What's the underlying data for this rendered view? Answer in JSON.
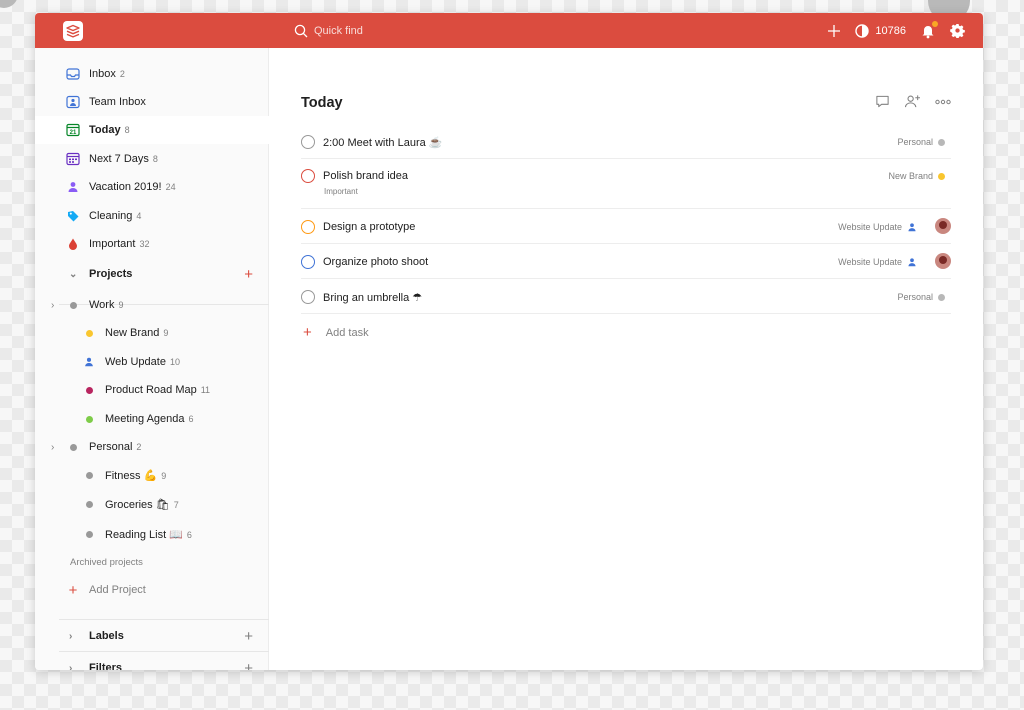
{
  "colors": {
    "brand": "#db4c3f",
    "accent_yellow": "#f9c62f",
    "blue": "#4073d6",
    "red": "#db4c3f",
    "orange": "#ff9a14"
  },
  "topbar": {
    "search_placeholder": "Quick find",
    "karma": "10786"
  },
  "sidebar": {
    "filters": [
      {
        "label": "Inbox",
        "count": "2",
        "icon": "inbox-icon"
      },
      {
        "label": "Team Inbox",
        "count": "",
        "icon": "team-inbox-icon"
      },
      {
        "label": "Today",
        "count": "8",
        "icon": "calendar-today-icon"
      },
      {
        "label": "Next 7 Days",
        "count": "8",
        "icon": "calendar-week-icon"
      },
      {
        "label": "Vacation 2019!",
        "count": "24",
        "icon": "person-icon"
      },
      {
        "label": "Cleaning",
        "count": "4",
        "icon": "tag-icon"
      },
      {
        "label": "Important",
        "count": "32",
        "icon": "drop-icon"
      }
    ],
    "projects_label": "Projects",
    "projects": [
      {
        "label": "Work",
        "count": "9",
        "color": "#999999"
      },
      {
        "label": "New Brand",
        "count": "9",
        "color": "#f9c62f"
      },
      {
        "label": "Web Update",
        "count": "10",
        "color": "#4073d6"
      },
      {
        "label": "Product Road Map",
        "count": "11",
        "color": "#b8255f"
      },
      {
        "label": "Meeting Agenda",
        "count": "6",
        "color": "#7ecc49"
      },
      {
        "label": "Personal",
        "count": "2",
        "color": "#999999"
      },
      {
        "label": "Fitness 💪",
        "count": "9",
        "color": "#999999"
      },
      {
        "label": "Groceries 🛍",
        "count": "7",
        "color": "#999999"
      },
      {
        "label": "Reading List 📖",
        "count": "6",
        "color": "#999999"
      }
    ],
    "archived": "Archived projects",
    "add_project": "Add Project",
    "labels": "Labels",
    "filters_section": "Filters"
  },
  "main": {
    "title": "Today",
    "tasks": [
      {
        "name": "2:00 Meet with Laura ☕",
        "sub": "",
        "project": "Personal",
        "project_color": "#b8b8b8",
        "ring": "#999999"
      },
      {
        "name": "Polish brand idea",
        "sub": "Important",
        "project": "New Brand",
        "project_color": "#f9c62f",
        "ring": "#db4c3f"
      },
      {
        "name": "Design a prototype",
        "sub": "",
        "project": "Website Update",
        "project_color": "#4073d6",
        "ring": "#ff9a14"
      },
      {
        "name": "Organize photo shoot",
        "sub": "",
        "project": "Website Update",
        "project_color": "#4073d6",
        "ring": "#4073d6"
      },
      {
        "name": "Bring an umbrella ☂",
        "sub": "",
        "project": "Personal",
        "project_color": "#b8b8b8",
        "ring": "#999999"
      }
    ],
    "add_task": "Add task"
  }
}
